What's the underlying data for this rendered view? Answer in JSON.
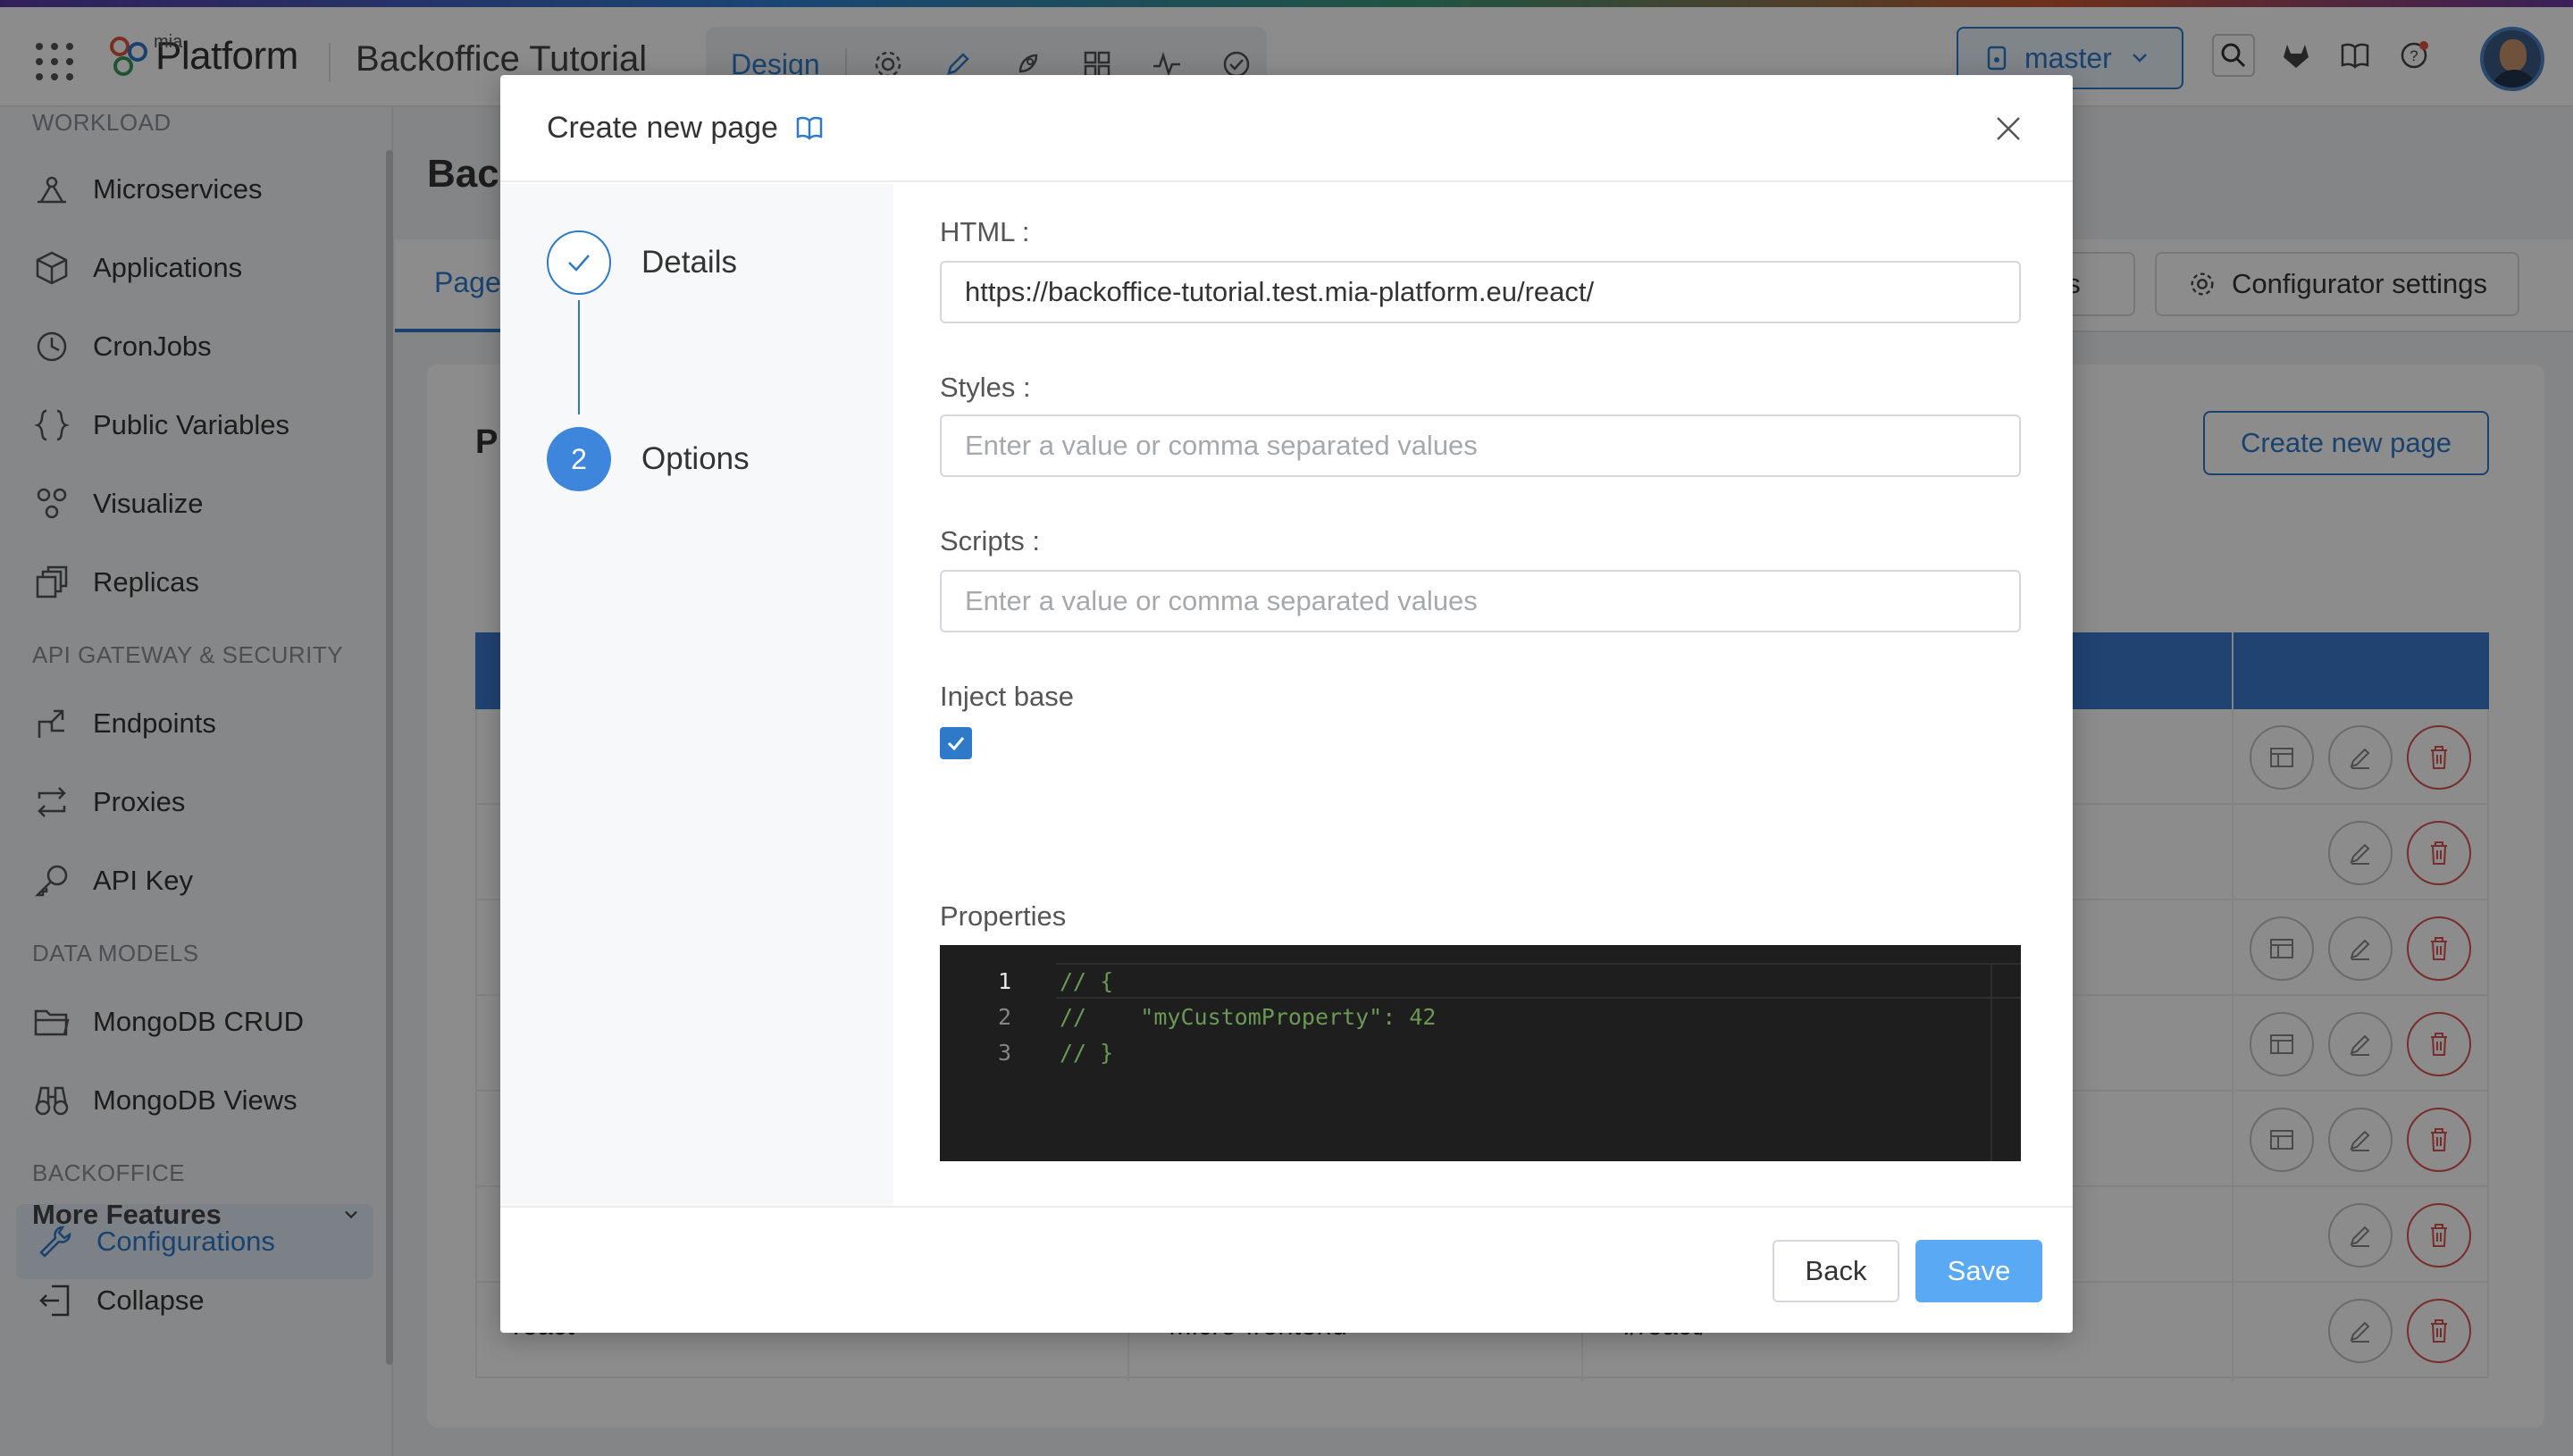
{
  "topbar": {
    "logo_small": "mia",
    "logo_name": "Platform",
    "project_title": "Backoffice Tutorial",
    "mode_label": "Design",
    "branch": "master"
  },
  "sidebar": {
    "sections": {
      "workload": "WORKLOAD",
      "api_gateway": "API GATEWAY & SECURITY",
      "data_models": "DATA MODELS",
      "backoffice": "BACKOFFICE"
    },
    "items": [
      {
        "label": "Microservices",
        "icon": "microservices-icon"
      },
      {
        "label": "Applications",
        "icon": "box-icon"
      },
      {
        "label": "CronJobs",
        "icon": "clock-icon"
      },
      {
        "label": "Public Variables",
        "icon": "braces-icon"
      },
      {
        "label": "Visualize",
        "icon": "nodes-icon"
      },
      {
        "label": "Replicas",
        "icon": "copies-icon"
      },
      {
        "label": "Endpoints",
        "icon": "endpoint-icon"
      },
      {
        "label": "Proxies",
        "icon": "swap-icon"
      },
      {
        "label": "API Key",
        "icon": "key-icon"
      },
      {
        "label": "MongoDB CRUD",
        "icon": "folder-icon"
      },
      {
        "label": "MongoDB Views",
        "icon": "binoculars-icon"
      },
      {
        "label": "Configurations",
        "icon": "wrench-icon",
        "active": true
      }
    ],
    "more_features": "More Features",
    "collapse": "Collapse"
  },
  "background": {
    "page_title_partial": "Bac",
    "tab_partial": "Page",
    "card_title_partial": "P",
    "btn_partial_left": "es",
    "configurator_settings": "Configurator settings",
    "create_new_page": "Create new page",
    "last_row": {
      "name": "react",
      "type": "Micro-frontend",
      "path": "./react/"
    }
  },
  "modal": {
    "title": "Create new page",
    "steps": [
      {
        "label": "Details",
        "status": "done"
      },
      {
        "label": "Options",
        "number": "2",
        "status": "current"
      }
    ],
    "html_label": "HTML",
    "html_value": "https://backoffice-tutorial.test.mia-platform.eu/react/",
    "styles_label": "Styles",
    "styles_placeholder": "Enter a value or comma separated values",
    "scripts_label": "Scripts",
    "scripts_placeholder": "Enter a value or comma separated values",
    "inject_base_label": "Inject base",
    "inject_base_checked": true,
    "properties_label": "Properties",
    "editor_lines": [
      {
        "num": "1",
        "text": "// {"
      },
      {
        "num": "2",
        "text": "//    \"myCustomProperty\": 42"
      },
      {
        "num": "3",
        "text": "// }"
      }
    ],
    "back_button": "Back",
    "save_button": "Save"
  },
  "colors": {
    "accent": "#2f7ac8",
    "save_button": "#5aa9f5",
    "table_header": "#3d7bd0",
    "delete": "#d9534f",
    "editor_bg": "#1e1e1e",
    "editor_comment": "#6a9955"
  }
}
